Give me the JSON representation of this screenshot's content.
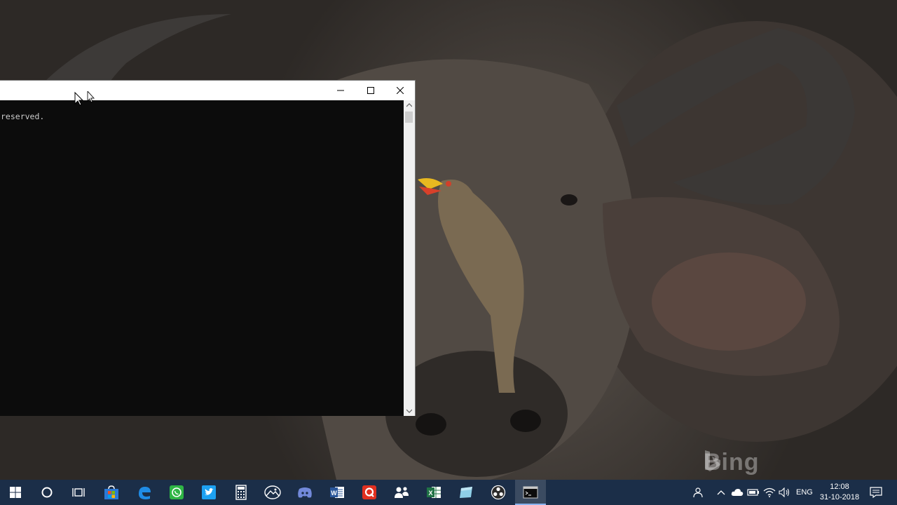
{
  "desktop": {
    "watermark": "Bing"
  },
  "console_window": {
    "title": "",
    "lines": [
      "reserved."
    ],
    "buttons": {
      "minimize": "minimize-icon",
      "maximize": "maximize-icon",
      "close": "close-icon"
    },
    "colors": {
      "background": "#0c0c0c",
      "text": "#cccccc",
      "titlebar": "#ffffff"
    }
  },
  "taskbar": {
    "color": "#1b2e48",
    "pinned": [
      {
        "name": "start-button",
        "icon": "windows-logo-icon"
      },
      {
        "name": "cortana-button",
        "icon": "cortana-circle-icon"
      },
      {
        "name": "task-view-button",
        "icon": "task-view-icon"
      },
      {
        "name": "microsoft-store",
        "icon": "store-bag-icon"
      },
      {
        "name": "edge",
        "icon": "edge-icon"
      },
      {
        "name": "whatsapp",
        "icon": "whatsapp-icon"
      },
      {
        "name": "twitter",
        "icon": "twitter-icon"
      },
      {
        "name": "calculator",
        "icon": "calculator-icon"
      },
      {
        "name": "photos",
        "icon": "photos-icon"
      },
      {
        "name": "discord",
        "icon": "discord-icon"
      },
      {
        "name": "word",
        "icon": "word-icon"
      },
      {
        "name": "quickheal",
        "icon": "q-icon"
      },
      {
        "name": "people",
        "icon": "people-icon"
      },
      {
        "name": "excel",
        "icon": "excel-icon"
      },
      {
        "name": "notes",
        "icon": "notes-icon"
      },
      {
        "name": "obs",
        "icon": "obs-icon"
      },
      {
        "name": "command-prompt",
        "icon": "cmd-icon",
        "active": true
      }
    ],
    "tray": {
      "language": "ENG",
      "time": "12:08",
      "date": "31-10-2018"
    }
  }
}
